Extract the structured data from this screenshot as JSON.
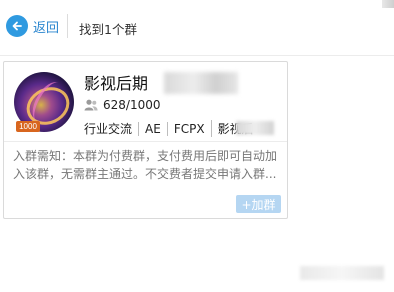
{
  "header": {
    "back_label": "返回",
    "result_text": "找到1个群"
  },
  "group_card": {
    "name": "影视后期",
    "members": "628/1000",
    "level_badge": "1000",
    "tags": [
      "行业交流",
      "AE",
      "FCPX",
      "影视后"
    ],
    "description": "入群需知：本群为付费群，支付费用后即可自动加入该群，无需群主通过。不交费者提交申请入群...",
    "join_label": "+加群"
  },
  "colors": {
    "accent": "#2f9ae0",
    "join_button": "#b5d6f2",
    "level_badge": "#d8661f"
  },
  "icons": {
    "back": "arrow-left-circle-icon",
    "members": "people-icon"
  }
}
